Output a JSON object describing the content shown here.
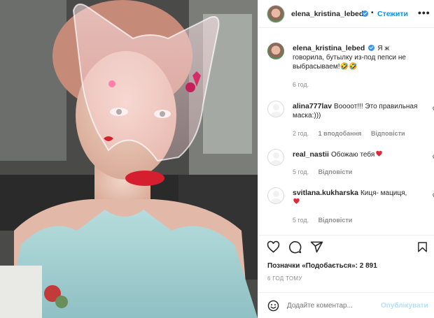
{
  "post": {
    "author": "elena_kristina_lebed",
    "follow_label": "Стежити",
    "more_icon": "•••"
  },
  "caption": {
    "user": "elena_kristina_lebed",
    "text": "Я ж говорила, бутылку из-под пепси не выбрасываем!🤣🤣",
    "time": "6 год."
  },
  "comments": [
    {
      "user": "alina777lav",
      "text": "Воооот!!! Это правильная маска:)))",
      "time": "2 год.",
      "likes": "1 вподобання",
      "reply": "Відповісти"
    },
    {
      "user": "real_nastii",
      "text": "Обожаю тебя",
      "time": "5 год.",
      "reply": "Відповісти"
    },
    {
      "user": "svitlana.kukharska",
      "text": "Киця- мациця,",
      "time": "5 год.",
      "reply": "Відповісти"
    }
  ],
  "likes_text": "Позначки «Подобається»: 2 891",
  "posted_ago": "6 ГОД ТОМУ",
  "add_comment": {
    "placeholder": "Додайте коментар...",
    "publish": "Опублікувати"
  },
  "colors": {
    "accent": "#0095f6",
    "publish_disabled": "#b2dffc",
    "muted": "#8e8e8e",
    "heart_red": "#ed4956"
  },
  "icons": [
    "heart-icon",
    "comment-icon",
    "share-icon",
    "bookmark-icon",
    "emoji-icon",
    "verified-icon"
  ]
}
